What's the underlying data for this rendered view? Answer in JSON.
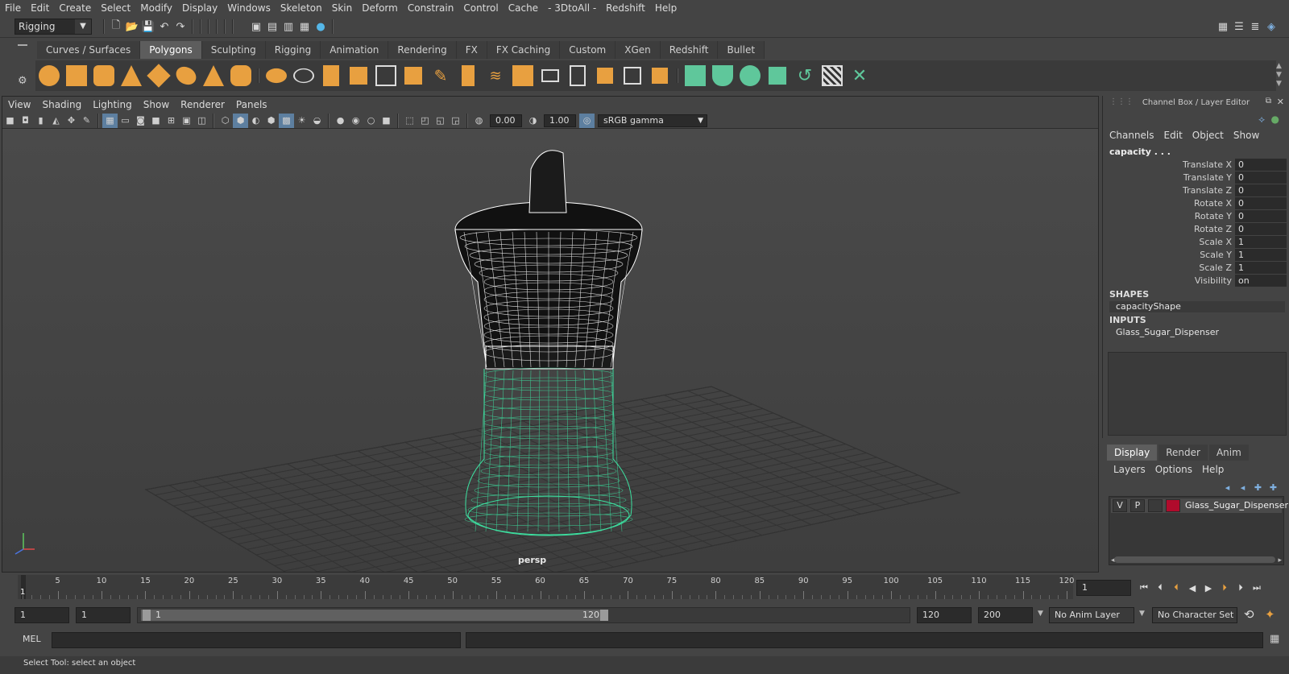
{
  "menubar": {
    "items": [
      "File",
      "Edit",
      "Create",
      "Select",
      "Modify",
      "Display",
      "Windows",
      "Skeleton",
      "Skin",
      "Deform",
      "Constrain",
      "Control",
      "Cache",
      "- 3DtoAll -",
      "Redshift",
      "Help"
    ]
  },
  "statusline": {
    "mode_selector": "Rigging"
  },
  "shelf": {
    "tabs": [
      "Curves / Surfaces",
      "Polygons",
      "Sculpting",
      "Rigging",
      "Animation",
      "Rendering",
      "FX",
      "FX Caching",
      "Custom",
      "XGen",
      "Redshift",
      "Bullet"
    ],
    "active_tab": "Polygons"
  },
  "viewport": {
    "menu": [
      "View",
      "Shading",
      "Lighting",
      "Show",
      "Renderer",
      "Panels"
    ],
    "exposure": "0.00",
    "gamma": "1.00",
    "color_space": "sRGB gamma",
    "camera_label": "persp"
  },
  "channel_box": {
    "title": "Channel Box / Layer Editor",
    "menu": [
      "Channels",
      "Edit",
      "Object",
      "Show"
    ],
    "object_name": "capacity . . .",
    "attributes": [
      {
        "label": "Translate X",
        "value": "0"
      },
      {
        "label": "Translate Y",
        "value": "0"
      },
      {
        "label": "Translate Z",
        "value": "0"
      },
      {
        "label": "Rotate X",
        "value": "0"
      },
      {
        "label": "Rotate Y",
        "value": "0"
      },
      {
        "label": "Rotate Z",
        "value": "0"
      },
      {
        "label": "Scale X",
        "value": "1"
      },
      {
        "label": "Scale Y",
        "value": "1"
      },
      {
        "label": "Scale Z",
        "value": "1"
      },
      {
        "label": "Visibility",
        "value": "on"
      }
    ],
    "shapes_header": "SHAPES",
    "shape_item": "capacityShape",
    "inputs_header": "INPUTS",
    "input_item": "Glass_Sugar_Dispenser"
  },
  "layer_editor": {
    "tabs": [
      "Display",
      "Render",
      "Anim"
    ],
    "active_tab": "Display",
    "menu": [
      "Layers",
      "Options",
      "Help"
    ],
    "layer": {
      "visible": "V",
      "playback": "P",
      "name": "Glass_Sugar_Dispenser",
      "color": "#b00b2c"
    }
  },
  "timeline": {
    "ticks": [
      "5",
      "10",
      "15",
      "20",
      "25",
      "30",
      "35",
      "40",
      "45",
      "50",
      "55",
      "60",
      "65",
      "70",
      "75",
      "80",
      "85",
      "90",
      "95",
      "100",
      "105",
      "110",
      "115",
      "120"
    ],
    "current_frame_marker": "1",
    "current_frame": "1"
  },
  "range": {
    "start": "1",
    "playback_start": "1",
    "slider_start": "1",
    "slider_end": "120",
    "playback_end": "120",
    "end": "200",
    "anim_layer": "No Anim Layer",
    "character_set": "No Character Set"
  },
  "command_line": {
    "label": "MEL"
  },
  "help_line": {
    "text": "Select Tool: select an object"
  },
  "colors": {
    "selection_green": "#3de0a0",
    "wireframe_white": "#ffffff",
    "accent_blue": "#5d7fa0"
  }
}
